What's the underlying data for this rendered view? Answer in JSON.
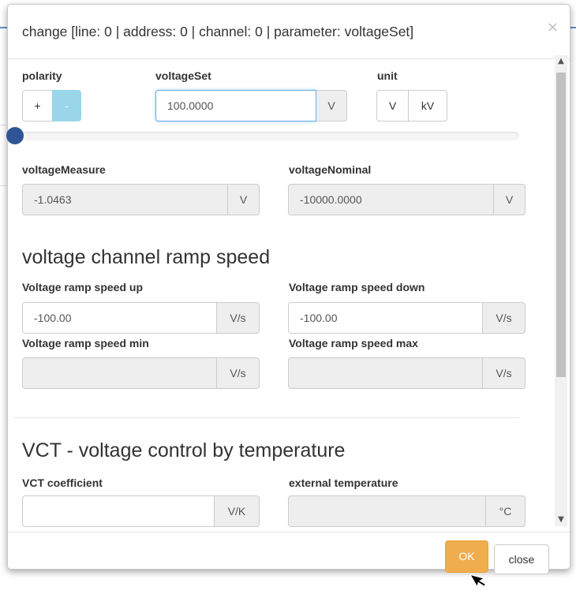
{
  "dialog": {
    "title": "change [line: 0 | address: 0 | channel: 0 | parameter: voltageSet]",
    "close_glyph": "×"
  },
  "polarity": {
    "label": "polarity",
    "plus": "+",
    "minus": "-",
    "selected": "-"
  },
  "voltage_set": {
    "label": "voltageSet",
    "value": "100.0000",
    "unit": "V",
    "slider_level": 0
  },
  "unit_select": {
    "label": "unit",
    "options": [
      "V",
      "kV"
    ]
  },
  "voltage_measure": {
    "label": "voltageMeasure",
    "value": "-1.0463",
    "unit": "V"
  },
  "voltage_nominal": {
    "label": "voltageNominal",
    "value": "-10000.0000",
    "unit": "V"
  },
  "ramp_section": {
    "title": "voltage channel ramp speed",
    "up": {
      "label": "Voltage ramp speed up",
      "value": "-100.00",
      "unit": "V/s"
    },
    "down": {
      "label": "Voltage ramp speed down",
      "value": "-100.00",
      "unit": "V/s"
    },
    "min": {
      "label": "Voltage ramp speed min",
      "value": "",
      "unit": "V/s"
    },
    "max": {
      "label": "Voltage ramp speed max",
      "value": "",
      "unit": "V/s"
    }
  },
  "vct_section": {
    "title": "VCT - voltage control by temperature",
    "coefficient": {
      "label": "VCT coefficient",
      "value": "",
      "unit": "V/K"
    },
    "external_temperature": {
      "label": "external temperature",
      "value": "",
      "unit": "°C"
    }
  },
  "footer": {
    "ok_label": "OK",
    "close_label": "close"
  },
  "colors": {
    "ok_button": "#f0ad4e",
    "polarity_active": "#99d6ea",
    "slider_handle": "#2f5597"
  }
}
